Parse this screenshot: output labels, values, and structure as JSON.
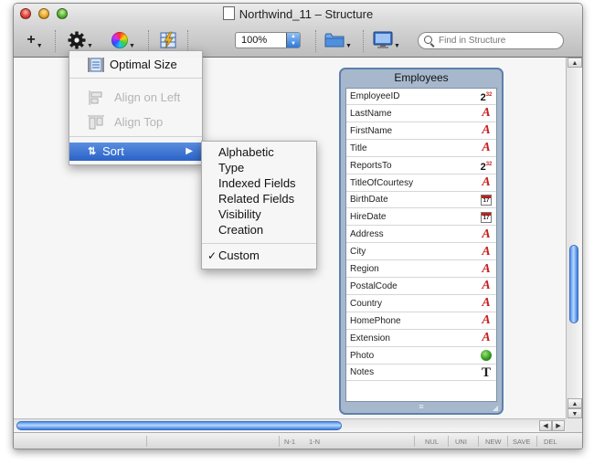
{
  "window": {
    "title": "Northwind_11 – Structure"
  },
  "toolbar": {
    "add_label": "+",
    "zoom_value": "100%",
    "search_placeholder": "Find in Structure"
  },
  "action_menu": {
    "items": [
      {
        "label": "Optimal Size",
        "enabled": true
      },
      {
        "label": "Align on Left",
        "enabled": false
      },
      {
        "label": "Align Top",
        "enabled": false
      },
      {
        "label": "Sort",
        "enabled": true,
        "highlighted": true,
        "submenu_arrow": "▶"
      }
    ]
  },
  "sort_submenu": {
    "items": [
      {
        "label": "Alphabetic",
        "checked": false
      },
      {
        "label": "Type",
        "checked": false
      },
      {
        "label": "Indexed Fields",
        "checked": false
      },
      {
        "label": "Related Fields",
        "checked": false
      },
      {
        "label": "Visibility",
        "checked": false
      },
      {
        "label": "Creation",
        "checked": false
      },
      {
        "label": "Custom",
        "checked": true
      }
    ],
    "check_glyph": "✓"
  },
  "entity": {
    "name": "Employees",
    "fields": [
      {
        "name": "EmployeeID",
        "type": "integer32"
      },
      {
        "name": "LastName",
        "type": "text"
      },
      {
        "name": "FirstName",
        "type": "text"
      },
      {
        "name": "Title",
        "type": "text"
      },
      {
        "name": "ReportsTo",
        "type": "integer32"
      },
      {
        "name": "TitleOfCourtesy",
        "type": "text"
      },
      {
        "name": "BirthDate",
        "type": "date"
      },
      {
        "name": "HireDate",
        "type": "date"
      },
      {
        "name": "Address",
        "type": "text"
      },
      {
        "name": "City",
        "type": "text"
      },
      {
        "name": "Region",
        "type": "text"
      },
      {
        "name": "PostalCode",
        "type": "text"
      },
      {
        "name": "Country",
        "type": "text"
      },
      {
        "name": "HomePhone",
        "type": "text"
      },
      {
        "name": "Extension",
        "type": "text"
      },
      {
        "name": "Photo",
        "type": "picture"
      },
      {
        "name": "Notes",
        "type": "memo"
      }
    ],
    "icon_glyphs": {
      "text": "A",
      "integer_base": "2",
      "integer_sup": "32",
      "date": "17",
      "memo": "T"
    },
    "resize_glyph": "≡"
  },
  "status_bar": {
    "labels": [
      "N-1",
      "1-N",
      "NUL",
      "UNI",
      "NEW",
      "SAVE",
      "DEL"
    ]
  },
  "colors": {
    "menu_highlight": "#2a63c7",
    "entity_border": "#5d80ad",
    "text_type_icon": "#c81e1e"
  }
}
